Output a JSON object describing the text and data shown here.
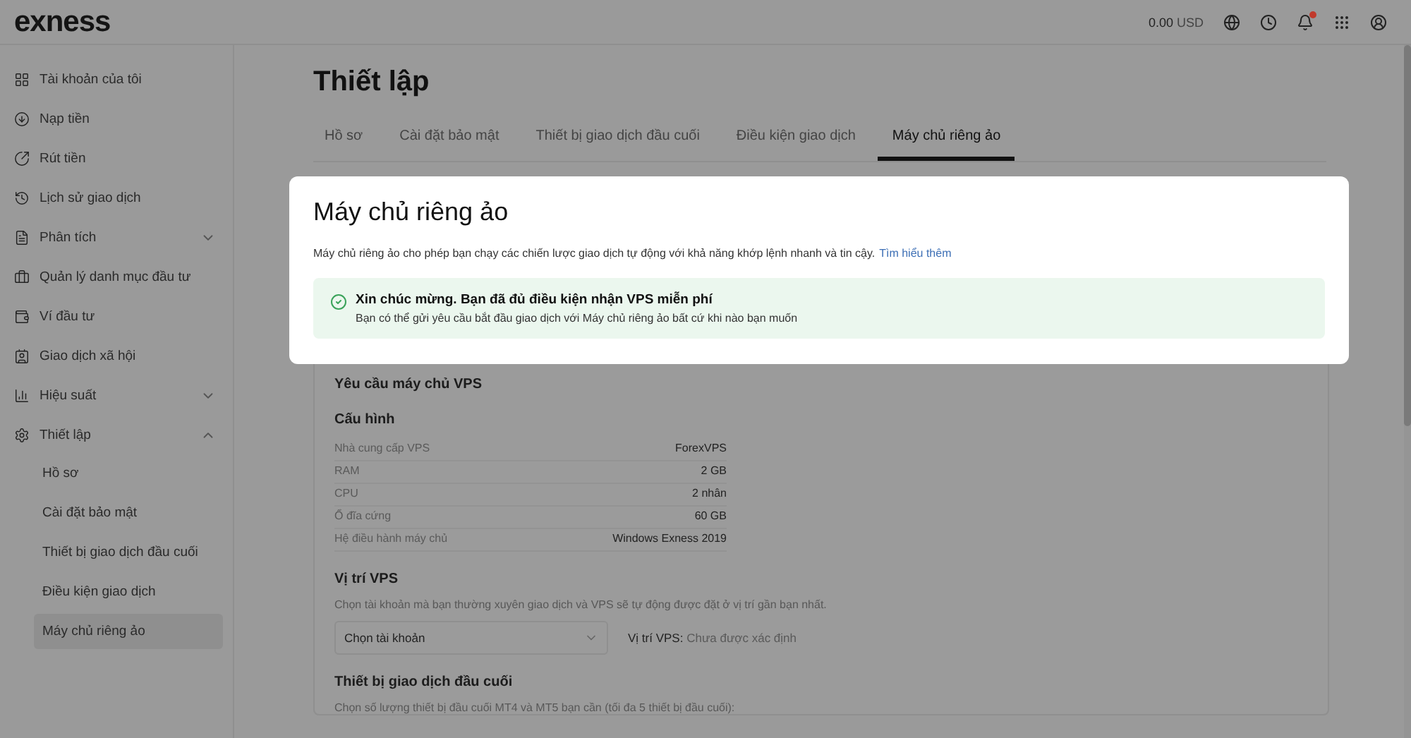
{
  "brand": "exness",
  "balance": {
    "amount": "0.00",
    "currency": "USD"
  },
  "notifications": {
    "unread": true
  },
  "sidebar": {
    "items": [
      {
        "label": "Tài khoản của tôi",
        "kind": "link"
      },
      {
        "label": "Nạp tiền",
        "kind": "link"
      },
      {
        "label": "Rút tiền",
        "kind": "link"
      },
      {
        "label": "Lịch sử giao dịch",
        "kind": "link"
      },
      {
        "label": "Phân tích",
        "kind": "group",
        "expanded": false
      },
      {
        "label": "Quản lý danh mục đầu tư",
        "kind": "link"
      },
      {
        "label": "Ví đầu tư",
        "kind": "link"
      },
      {
        "label": "Giao dịch xã hội",
        "kind": "link"
      },
      {
        "label": "Hiệu suất",
        "kind": "group",
        "expanded": false
      },
      {
        "label": "Thiết lập",
        "kind": "group",
        "expanded": true,
        "children": [
          {
            "label": "Hồ sơ",
            "selected": false
          },
          {
            "label": "Cài đặt bảo mật",
            "selected": false
          },
          {
            "label": "Thiết bị giao dịch đầu cuối",
            "selected": false
          },
          {
            "label": "Điều kiện giao dịch",
            "selected": false
          },
          {
            "label": "Máy chủ riêng ảo",
            "selected": true
          }
        ]
      }
    ]
  },
  "page_title": "Thiết lập",
  "tabs": [
    {
      "label": "Hồ sơ",
      "selected": false
    },
    {
      "label": "Cài đặt bảo mật",
      "selected": false
    },
    {
      "label": "Thiết bị giao dịch đầu cuối",
      "selected": false
    },
    {
      "label": "Điều kiện giao dịch",
      "selected": false
    },
    {
      "label": "Máy chủ riêng ảo",
      "selected": true
    }
  ],
  "intro": {
    "title": "Máy chủ riêng ảo",
    "description": "Máy chủ riêng ảo cho phép bạn chạy các chiến lược giao dịch tự động với khả năng khớp lệnh nhanh và tin cậy.",
    "link": "Tìm hiểu thêm",
    "alert": {
      "title": "Xin chúc mừng. Bạn đã đủ điều kiện nhận VPS miễn phí",
      "text": "Bạn có thể gửi yêu cầu bắt đầu giao dịch với Máy chủ riêng ảo bất cứ khi nào bạn muốn"
    }
  },
  "request": {
    "title": "Yêu cầu máy chủ VPS",
    "config": {
      "title": "Cấu hình",
      "rows": [
        {
          "label": "Nhà cung cấp VPS",
          "value": "ForexVPS"
        },
        {
          "label": "RAM",
          "value": "2 GB"
        },
        {
          "label": "CPU",
          "value": "2 nhân"
        },
        {
          "label": "Ổ đĩa cứng",
          "value": "60 GB"
        },
        {
          "label": "Hệ điều hành máy chủ",
          "value": "Windows Exness 2019"
        }
      ]
    },
    "location": {
      "title": "Vị trí VPS",
      "description": "Chọn tài khoản mà bạn thường xuyên giao dịch và VPS sẽ tự động được đặt ở vị trí gần bạn nhất.",
      "select": "Chọn tài khoản",
      "label": "Vị trí VPS:",
      "value": "Chưa được xác định"
    },
    "terminals": {
      "title": "Thiết bị giao dịch đầu cuối",
      "description": "Chọn số lượng thiết bị đầu cuối MT4 và MT5 bạn cần (tối đa 5 thiết bị đầu cuối):"
    }
  }
}
